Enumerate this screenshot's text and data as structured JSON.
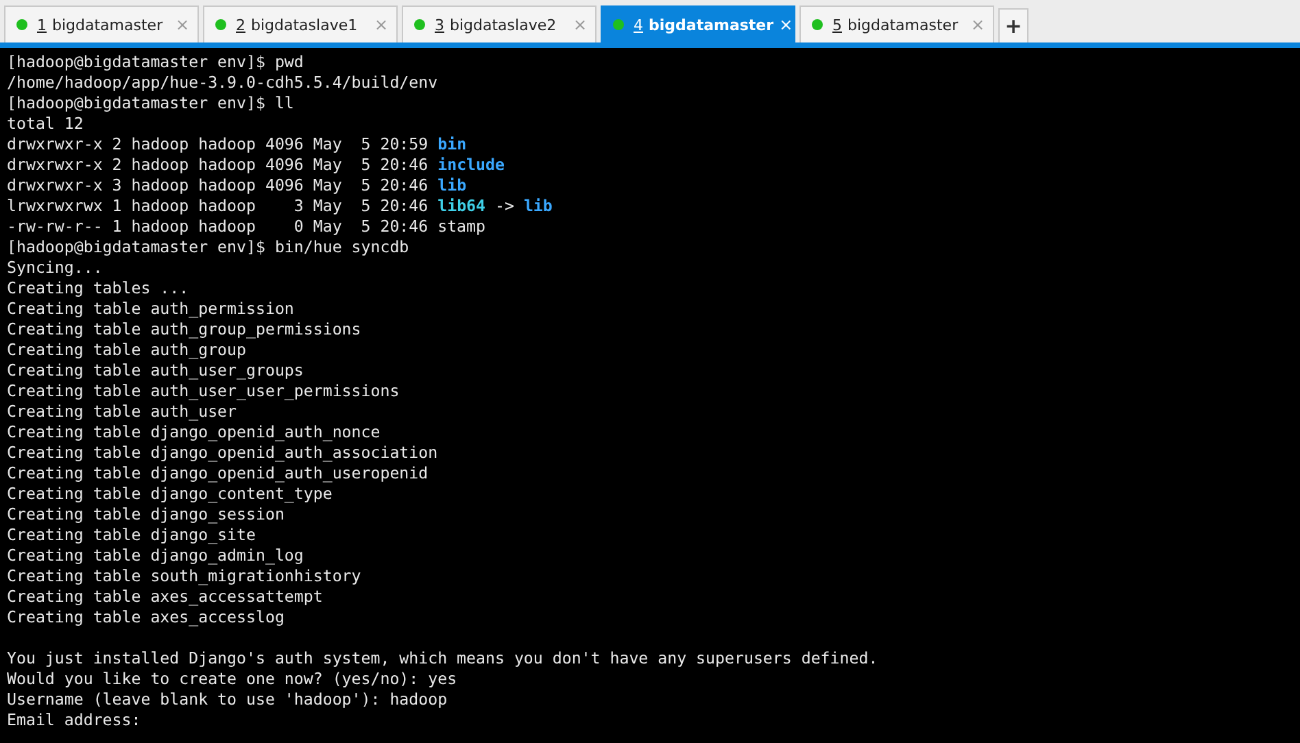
{
  "tabs": [
    {
      "number": "1",
      "title": "bigdatamaster",
      "selected": false,
      "connected": true
    },
    {
      "number": "2",
      "title": "bigdataslave1",
      "selected": false,
      "connected": true
    },
    {
      "number": "3",
      "title": "bigdataslave2",
      "selected": false,
      "connected": true
    },
    {
      "number": "4",
      "title": "bigdatamaster",
      "selected": true,
      "connected": true
    },
    {
      "number": "5",
      "title": "bigdatamaster",
      "selected": false,
      "connected": true
    }
  ],
  "new_tab_label": "+",
  "close_label": "×",
  "terminal": {
    "lines": [
      {
        "kind": "text",
        "text": "[hadoop@bigdatamaster env]$ pwd"
      },
      {
        "kind": "text",
        "text": "/home/hadoop/app/hue-3.9.0-cdh5.5.4/build/env"
      },
      {
        "kind": "text",
        "text": "[hadoop@bigdatamaster env]$ ll"
      },
      {
        "kind": "text",
        "text": "total 12"
      },
      {
        "kind": "entry",
        "text": "drwxrwxr-x 2 hadoop hadoop 4096 May  5 20:59",
        "name": "bin"
      },
      {
        "kind": "entry",
        "text": "drwxrwxr-x 2 hadoop hadoop 4096 May  5 20:46",
        "name": "include"
      },
      {
        "kind": "entry",
        "text": "drwxrwxr-x 3 hadoop hadoop 4096 May  5 20:46",
        "name": "lib"
      },
      {
        "kind": "link",
        "text": "lrwxrwxrwx 1 hadoop hadoop    3 May  5 20:46",
        "name": "lib64",
        "arrow": "->",
        "target": "lib"
      },
      {
        "kind": "text",
        "text": "-rw-rw-r-- 1 hadoop hadoop    0 May  5 20:46 stamp"
      },
      {
        "kind": "text",
        "text": "[hadoop@bigdatamaster env]$ bin/hue syncdb"
      },
      {
        "kind": "text",
        "text": "Syncing..."
      },
      {
        "kind": "text",
        "text": "Creating tables ..."
      },
      {
        "kind": "text",
        "text": "Creating table auth_permission"
      },
      {
        "kind": "text",
        "text": "Creating table auth_group_permissions"
      },
      {
        "kind": "text",
        "text": "Creating table auth_group"
      },
      {
        "kind": "text",
        "text": "Creating table auth_user_groups"
      },
      {
        "kind": "text",
        "text": "Creating table auth_user_user_permissions"
      },
      {
        "kind": "text",
        "text": "Creating table auth_user"
      },
      {
        "kind": "text",
        "text": "Creating table django_openid_auth_nonce"
      },
      {
        "kind": "text",
        "text": "Creating table django_openid_auth_association"
      },
      {
        "kind": "text",
        "text": "Creating table django_openid_auth_useropenid"
      },
      {
        "kind": "text",
        "text": "Creating table django_content_type"
      },
      {
        "kind": "text",
        "text": "Creating table django_session"
      },
      {
        "kind": "text",
        "text": "Creating table django_site"
      },
      {
        "kind": "text",
        "text": "Creating table django_admin_log"
      },
      {
        "kind": "text",
        "text": "Creating table south_migrationhistory"
      },
      {
        "kind": "text",
        "text": "Creating table axes_accessattempt"
      },
      {
        "kind": "text",
        "text": "Creating table axes_accesslog"
      },
      {
        "kind": "blank"
      },
      {
        "kind": "text",
        "text": "You just installed Django's auth system, which means you don't have any superusers defined."
      },
      {
        "kind": "text",
        "text": "Would you like to create one now? (yes/no): yes"
      },
      {
        "kind": "text",
        "text": "Username (leave blank to use 'hadoop'): hadoop"
      },
      {
        "kind": "text",
        "text": "Email address:"
      }
    ]
  }
}
